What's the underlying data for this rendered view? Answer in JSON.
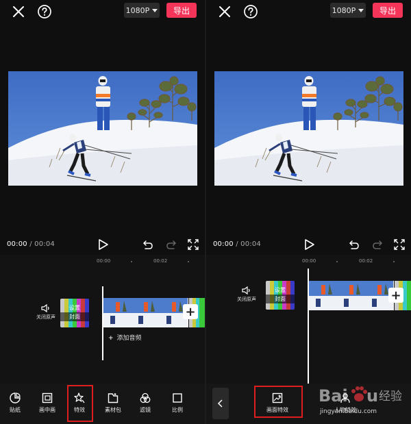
{
  "left": {
    "resolution": "1080P",
    "export": "导出",
    "time_current": "00:00",
    "time_total": "/ 00:04",
    "ruler": [
      "00:00",
      "00:02"
    ],
    "audio_toggle": "关闭原声",
    "cover_line1": "设置",
    "cover_line2": "封面",
    "add_audio": "添加音频",
    "toolbar": [
      {
        "label": "贴纸",
        "icon": "sticker-icon"
      },
      {
        "label": "画中画",
        "icon": "pip-icon"
      },
      {
        "label": "特效",
        "icon": "effects-icon"
      },
      {
        "label": "素材包",
        "icon": "material-pack-icon"
      },
      {
        "label": "滤镜",
        "icon": "filter-icon"
      },
      {
        "label": "比例",
        "icon": "ratio-icon"
      }
    ]
  },
  "right": {
    "resolution": "1080P",
    "export": "导出",
    "time_current": "00:00",
    "time_total": "/ 00:04",
    "ruler": [
      "00:00",
      "00:02"
    ],
    "audio_toggle": "关闭原声",
    "cover_line1": "设置",
    "cover_line2": "封面",
    "toolbar": [
      {
        "label": "画面特效",
        "icon": "screen-effects-icon"
      }
    ],
    "partial_label": "人物特效",
    "watermark": "jingyan.baidu.com"
  },
  "colors": {
    "accent": "#f5345a",
    "highlight": "#e01e1e",
    "sky": "#4a76c9"
  }
}
